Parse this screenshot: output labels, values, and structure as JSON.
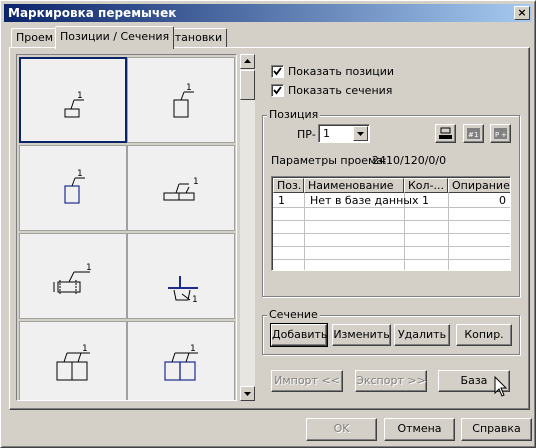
{
  "window": {
    "title": "Маркировка перемычек",
    "close_glyph": "×"
  },
  "tabs": [
    {
      "label": "Проем",
      "active": false
    },
    {
      "label": "Позиции / Сечения",
      "active": true
    },
    {
      "label": "Установки",
      "active": false
    }
  ],
  "options": {
    "show_positions": {
      "label": "Показать позиции",
      "checked": true
    },
    "show_sections": {
      "label": "Показать сечения",
      "checked": true
    }
  },
  "position_group": {
    "title": "Позиция",
    "pr_label": "ПР-",
    "pr_value": "1",
    "icons": [
      "position-block-icon",
      "position-numbering-icon",
      "position-renumber-icon"
    ],
    "opening_params_label": "Параметры проема:",
    "opening_params_value": "2410/120/0/0",
    "table": {
      "columns": [
        "Поз.",
        "Наименование",
        "Кол-...",
        "Опирание"
      ],
      "rows": [
        {
          "pos": "1",
          "name": "Нет в базе данных",
          "qty": "1",
          "support": "0"
        }
      ]
    }
  },
  "section_group": {
    "title": "Сечение",
    "buttons": [
      "Добавить",
      "Изменить",
      "Удалить",
      "Копир."
    ]
  },
  "io_buttons": {
    "import": "Импорт <<",
    "export": "Экспорт >>",
    "base": "База"
  },
  "footer": {
    "ok": "OK",
    "cancel": "Отмена",
    "help": "Справка"
  },
  "thumbnails": {
    "label": "1",
    "items": [
      {
        "icon": "single-lintel-icon",
        "selected": true
      },
      {
        "icon": "square-lintel-icon",
        "selected": false
      },
      {
        "icon": "blue-square-lintel-icon",
        "selected": false
      },
      {
        "icon": "double-bar-lintel-icon",
        "selected": false
      },
      {
        "icon": "dimensioned-lintel-icon",
        "selected": false
      },
      {
        "icon": "t-beam-lintel-icon",
        "selected": false
      },
      {
        "icon": "double-box-lintel-icon",
        "selected": false
      },
      {
        "icon": "blue-double-box-lintel-icon",
        "selected": false
      }
    ]
  },
  "colors": {
    "titlebar": "#0a246a",
    "accent_blue": "#1c2c8c",
    "face": "#d4d0c8"
  }
}
